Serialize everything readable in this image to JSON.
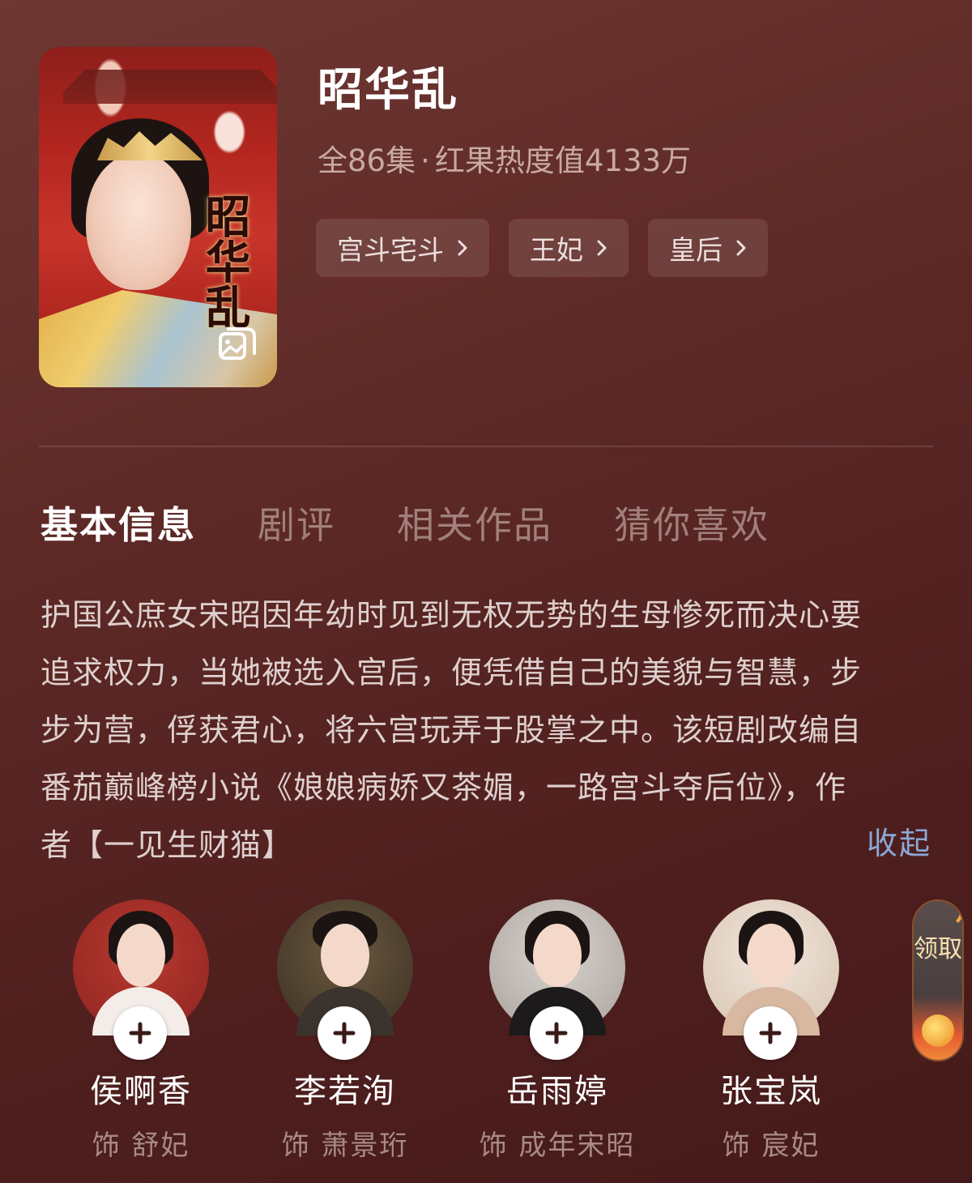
{
  "drama": {
    "title": "昭华乱",
    "poster_title": "昭华乱",
    "episodes": "全86集",
    "separator": "·",
    "heat": "红果热度值4133万",
    "tags": [
      {
        "label": "宫斗宅斗"
      },
      {
        "label": "王妃"
      },
      {
        "label": "皇后"
      }
    ]
  },
  "tabs": [
    {
      "label": "基本信息",
      "active": true
    },
    {
      "label": "剧评",
      "active": false
    },
    {
      "label": "相关作品",
      "active": false
    },
    {
      "label": "猜你喜欢",
      "active": false
    }
  ],
  "synopsis": {
    "lines": [
      "护国公庶女宋昭因年幼时见到无权无势的生母惨死而决心要",
      "追求权力，当她被选入宫后，便凭借自己的美貌与智慧，步",
      "步为营，俘获君心，将六宫玩弄于股掌之中。该短剧改编自",
      "番茄巅峰榜小说《娘娘病娇又茶媚，一路宫斗夺后位》，作",
      "者【一见生财猫】"
    ],
    "collapse_label": "收起"
  },
  "cast": [
    {
      "name": "侯啊香",
      "role": "饰 舒妃"
    },
    {
      "name": "李若洵",
      "role": "饰 萧景珩"
    },
    {
      "name": "岳雨婷",
      "role": "饰 成年宋昭"
    },
    {
      "name": "张宝岚",
      "role": "饰 宸妃"
    }
  ],
  "reward_widget": {
    "label": "领取"
  },
  "colors": {
    "background": "#5e2a27",
    "accent_link": "#8aa8d8",
    "muted_text": "#c9a9a5"
  },
  "icons": {
    "gallery": "gallery-icon",
    "tag_chevron": "chevron-right-icon",
    "follow": "plus-icon"
  }
}
